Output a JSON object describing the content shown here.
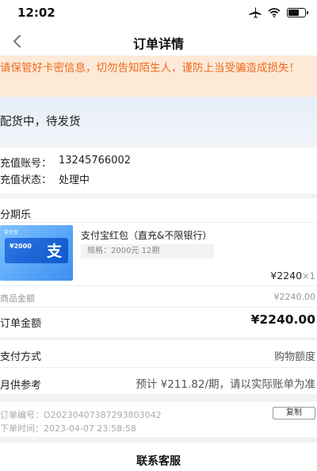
{
  "status_bar": {
    "time": "12:02",
    "icons": [
      "airplane-icon",
      "wifi-icon",
      "battery-charging-icon"
    ]
  },
  "nav": {
    "title": "订单详情",
    "back_icon": "chevron-left-icon"
  },
  "warning": {
    "text": "请保管好卡密信息，切勿告知陌生人，谨防上当受骗造成损失！",
    "color": "#ee6a1e",
    "background": "#fde9d7"
  },
  "order_status": {
    "text": "配货中，待发货"
  },
  "recharge": {
    "account_label": "充值账号：",
    "account_value": "13245766002",
    "status_label": "充值状态：",
    "status_value": "处理中"
  },
  "product": {
    "store": "分期乐",
    "title": "支付宝红包（直充&不限银行）",
    "spec": "规格：2000元 12期",
    "thumb_amount": "¥2000",
    "thumb_brand": "支付宝",
    "thumb_glyph": "支",
    "price": "¥2240",
    "qty": "×1",
    "subtotal_label": "商品金额",
    "subtotal_value": "¥2240.00",
    "order_amount_label": "订单金额",
    "order_amount_value": "¥2240.00"
  },
  "payment": {
    "method_label": "支付方式",
    "method_value": "购物额度",
    "monthly_label": "月供参考",
    "monthly_value": "预计 ¥211.82/期，请以实际账单为准"
  },
  "order_meta": {
    "number_label": "订单编号：",
    "number_value": "O20230407387293803042",
    "time_label": "下单时间：",
    "time_value": "2023-04-07 23:58:58",
    "copy_label": "复制"
  },
  "contact": {
    "label": "联系客服"
  }
}
